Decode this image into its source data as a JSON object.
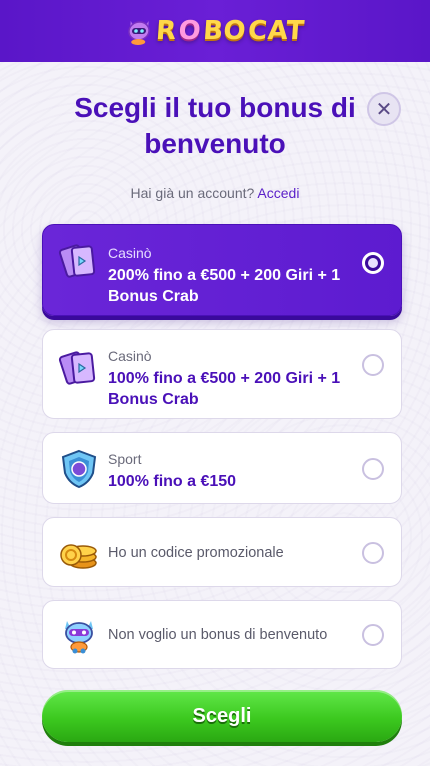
{
  "header": {
    "logo_text_left": "R",
    "logo_text_o": "O",
    "logo_text_mid": "BO",
    "logo_text_right": "CAT"
  },
  "dialog": {
    "title": "Scegli il tuo bonus di benvenuto",
    "close_glyph": "✕",
    "account_prompt": "Hai già un account?",
    "login_link": "Accedi"
  },
  "options": [
    {
      "category": "Casinò",
      "title": "200% fino a €500 + 200 Giri + 1 Bonus Crab",
      "selected": true,
      "icon": "casino-tickets-icon"
    },
    {
      "category": "Casinò",
      "title": "100% fino a €500 + 200 Giri + 1 Bonus Crab",
      "selected": false,
      "icon": "casino-tickets-icon"
    },
    {
      "category": "Sport",
      "title": "100% fino a €150",
      "selected": false,
      "icon": "sport-shield-icon"
    },
    {
      "category": "",
      "title": "Ho un codice promozionale",
      "selected": false,
      "icon": "coins-icon"
    },
    {
      "category": "",
      "title": "Non voglio un bonus di benvenuto",
      "selected": false,
      "icon": "robot-icon"
    }
  ],
  "submit": {
    "label": "Scegli"
  },
  "colors": {
    "brand_purple": "#5a16c8",
    "title_purple": "#4a10b8",
    "cta_green": "#3cc91f",
    "logo_yellow": "#ffd84a"
  }
}
